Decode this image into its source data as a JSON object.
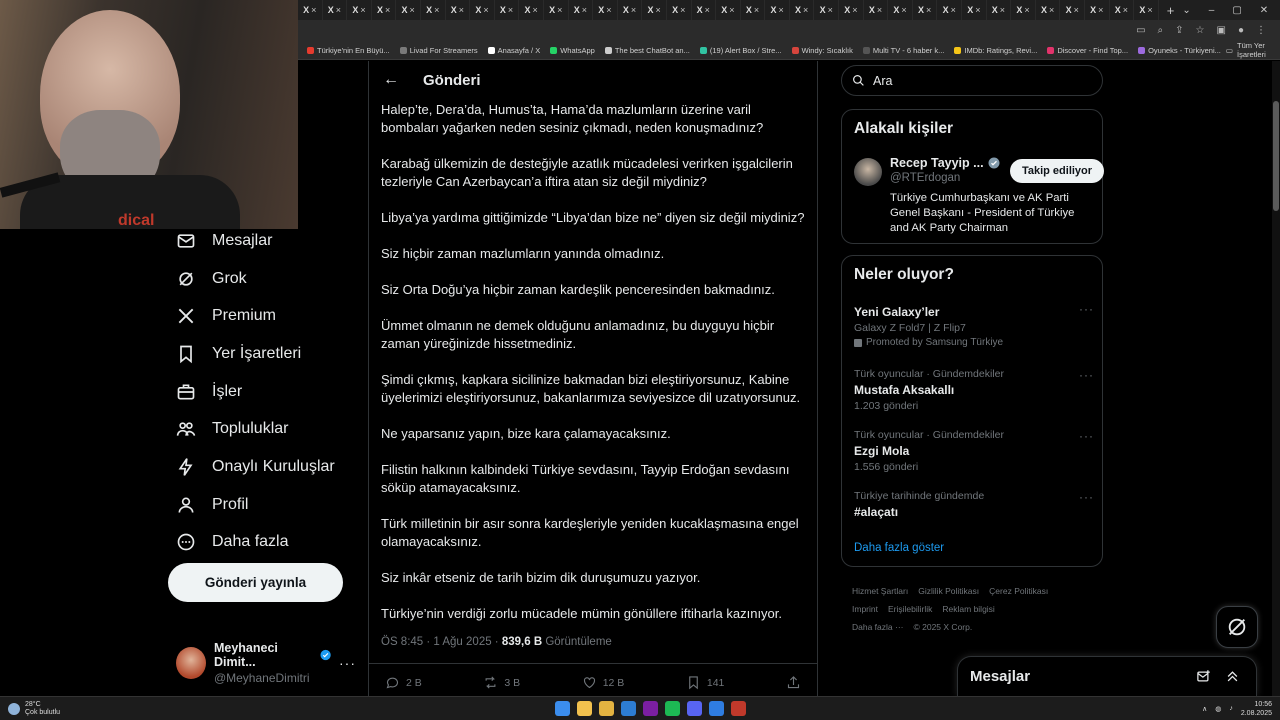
{
  "browser": {
    "tab_labels": [
      "X",
      "X",
      "X",
      "X",
      "X",
      "X",
      "X",
      "X",
      "X",
      "X",
      "X",
      "X",
      "X",
      "X",
      "X",
      "X",
      "X",
      "X",
      "X",
      "X",
      "X",
      "X",
      "X",
      "X",
      "X",
      "X",
      "X",
      "X",
      "X",
      "X",
      "X",
      "X",
      "X",
      "X",
      "X"
    ],
    "new_tab": "+",
    "bookmarks": [
      {
        "label": "Türkiye'nin En Büyü...",
        "color": "#e63b2e"
      },
      {
        "label": "Livad For Streamers",
        "color": "#7a7a7a"
      },
      {
        "label": "Anasayfa / X",
        "color": "#ffffff"
      },
      {
        "label": "WhatsApp",
        "color": "#25d366"
      },
      {
        "label": "The best ChatBot an...",
        "color": "#cccccc"
      },
      {
        "label": "(19) Alert Box / Stre...",
        "color": "#31c3a2"
      },
      {
        "label": "Windy: Sıcaklık",
        "color": "#d6453d"
      },
      {
        "label": "Multi TV - 6 haber k...",
        "color": "#555555"
      },
      {
        "label": "IMDb: Ratings, Revi...",
        "color": "#f5c518"
      },
      {
        "label": "Discover - Find Top...",
        "color": "#e2336b"
      },
      {
        "label": "Oyuneks - Türkiyeni...",
        "color": "#9c6ade"
      }
    ],
    "all_bookmarks": "Tüm Yer İşaretleri"
  },
  "webcam": {
    "shirt_text": "dical"
  },
  "nav": {
    "items": [
      {
        "label": "Mesajlar",
        "icon": "mail-icon"
      },
      {
        "label": "Grok",
        "icon": "grok-icon"
      },
      {
        "label": "Premium",
        "icon": "x-logo-icon"
      },
      {
        "label": "Yer İşaretleri",
        "icon": "bookmark-icon"
      },
      {
        "label": "İşler",
        "icon": "briefcase-icon"
      },
      {
        "label": "Topluluklar",
        "icon": "communities-icon"
      },
      {
        "label": "Onaylı Kuruluşlar",
        "icon": "lightning-icon"
      },
      {
        "label": "Profil",
        "icon": "person-icon"
      },
      {
        "label": "Daha fazla",
        "icon": "more-circle-icon"
      }
    ],
    "post_button": "Gönderi yayınla"
  },
  "account": {
    "name": "Meyhaneci Dimit...",
    "handle": "@MeyhaneDimitri",
    "more": "···"
  },
  "post": {
    "header": "Gönderi",
    "paragraphs": [
      "Halep’te, Dera’da, Humus’ta, Hama’da mazlumların üzerine varil bombaları yağarken neden sesiniz çıkmadı, neden konuşmadınız?",
      "Karabağ ülkemizin de desteğiyle azatlık mücadelesi verirken işgalcilerin tezleriyle Can Azerbaycan’a iftira atan siz değil miydiniz?",
      "Libya’ya yardıma gittiğimizde “Libya’dan bize ne” diyen siz değil miydiniz?",
      "Siz hiçbir zaman mazlumların yanında olmadınız.",
      "Siz Orta Doğu’ya hiçbir zaman kardeşlik penceresinden bakmadınız.",
      "Ümmet olmanın ne demek olduğunu anlamadınız, bu duyguyu hiçbir zaman yüreğinizde hissetmediniz.",
      "Şimdi çıkmış, kapkara sicilinize bakmadan bizi eleştiriyorsunuz, Kabine üyelerimizi eleştiriyorsunuz, bakanlarımıza seviyesizce dil uzatıyorsunuz.",
      "Ne yaparsanız yapın, bize kara çalamayacaksınız.",
      "Filistin halkının kalbindeki Türkiye sevdasını, Tayyip Erdoğan sevdasını söküp atamayacaksınız.",
      "Türk milletinin bir asır sonra kardeşleriyle yeniden kucaklaşmasına engel olamayacaksınız.",
      "Siz inkâr etseniz de tarih bizim dik duruşumuzu yazıyor.",
      "Türkiye’nin verdiği zorlu mücadele mümin gönüllere iftiharla kazınıyor."
    ],
    "timestamp": "ÖS 8:45 · 1 Ağu 2025 · ",
    "views": "839,6 B",
    "views_label": " Görüntüleme",
    "actions": {
      "replies": "2 B",
      "reposts": "3 B",
      "likes": "12 B",
      "bookmarks": "141"
    }
  },
  "search": {
    "placeholder": "Ara"
  },
  "related": {
    "title": "Alakalı kişiler",
    "name": "Recep Tayyip ...",
    "handle": "@RTErdogan",
    "follow_label": "Takip ediliyor",
    "bio": "Türkiye Cumhurbaşkanı ve AK Parti Genel Başkanı - President of Türkiye and AK Party Chairman"
  },
  "trends": {
    "title": "Neler oluyor?",
    "promo": {
      "title": "Yeni Galaxy’ler",
      "subtitle": "Galaxy Z Fold7 | Z Flip7",
      "promoted": "Promoted by Samsung Türkiye"
    },
    "items": [
      {
        "context": "Türk oyuncular · Gündemdekiler",
        "title": "Mustafa Aksakallı",
        "count": "1.203 gönderi"
      },
      {
        "context": "Türk oyuncular · Gündemdekiler",
        "title": "Ezgi Mola",
        "count": "1.556 gönderi"
      },
      {
        "context": "Türkiye tarihinde gündemde",
        "title": "#alaçatı",
        "count": ""
      }
    ],
    "more_label": "···",
    "show_more": "Daha fazla göster"
  },
  "footer": {
    "links": [
      "Hizmet Şartları",
      "Gizlilik Politikası",
      "Çerez Politikası",
      "Imprint",
      "Erişilebilirlik",
      "Reklam bilgisi",
      "Daha fazla ···",
      "© 2025 X Corp."
    ]
  },
  "messages_dock": {
    "title": "Mesajlar"
  },
  "taskbar": {
    "temp": "28°C",
    "weather": "Çok bulutlu",
    "time": "10:56",
    "date": "2.08.2025"
  }
}
